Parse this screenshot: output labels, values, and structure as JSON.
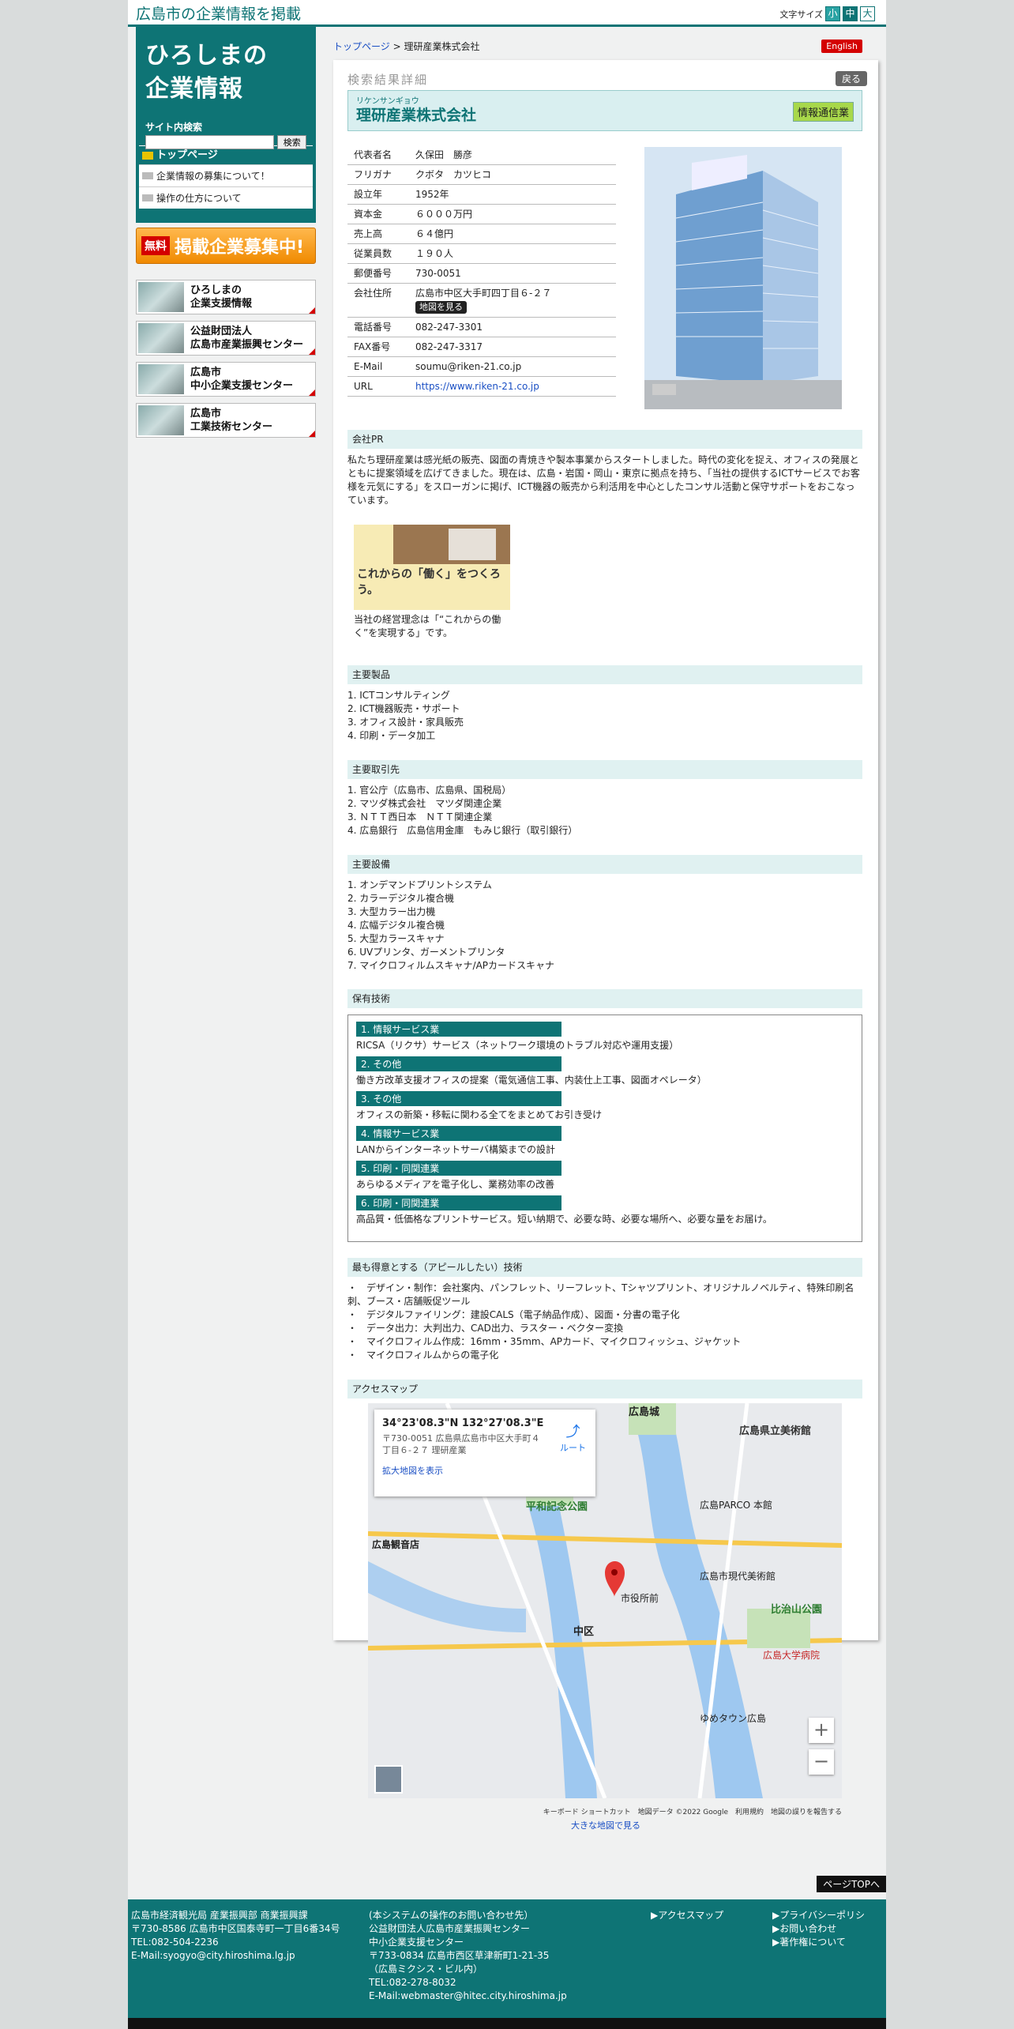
{
  "site": {
    "name": "広島市の企業情報を掲載",
    "font_size_label": "文字サイズ",
    "sizes": [
      "小",
      "中",
      "大"
    ]
  },
  "sidebar": {
    "logo": [
      "ひろしまの",
      "企業情報"
    ],
    "search_label": "サイト内検索",
    "search_button": "検索",
    "nav_head": "トップページ",
    "nav_items": [
      "企業情報の募集について！",
      "操作の仕方について"
    ],
    "banner_free": "無料",
    "banner_text": "掲載企業募集中!",
    "links": [
      [
        "ひろしまの",
        "企業支援情報"
      ],
      [
        "公益財団法人",
        "広島市産業振興センター"
      ],
      [
        "広島市",
        "中小企業支援センター"
      ],
      [
        "広島市",
        "工業技術センター"
      ]
    ]
  },
  "breadcrumb": {
    "home": "トップページ",
    "sep": " > ",
    "current": "理研産業株式会社"
  },
  "english": "English",
  "result_title": "検索結果詳細",
  "back": "戻る",
  "company": {
    "furigana": "リケンサンギョウ",
    "name": "理研産業株式会社",
    "industry": "情報通信業"
  },
  "info": [
    {
      "k": "代表者名",
      "v": "久保田　勝彦"
    },
    {
      "k": "フリガナ",
      "v": "クボタ　カツヒコ"
    },
    {
      "k": "設立年",
      "v": "1952年"
    },
    {
      "k": "資本金",
      "v": "６０００万円"
    },
    {
      "k": "売上高",
      "v": "６４億円"
    },
    {
      "k": "従業員数",
      "v": "１９０人"
    },
    {
      "k": "郵便番号",
      "v": "730-0051"
    },
    {
      "k": "会社住所",
      "v": "広島市中区大手町四丁目６-２７"
    },
    {
      "k": "電話番号",
      "v": "082-247-3301"
    },
    {
      "k": "FAX番号",
      "v": "082-247-3317"
    },
    {
      "k": "E-Mail",
      "v": "soumu@riken-21.co.jp"
    },
    {
      "k": "URL",
      "v": "https://www.riken-21.co.jp"
    }
  ],
  "map_button": "地図を見る",
  "pr": {
    "head": "会社PR",
    "text": "私たち理研産業は感光紙の販売、図面の青焼きや製本事業からスタートしました。時代の変化を捉え、オフィスの発展とともに提案領域を広げてきました。現在は、広島・岩国・岡山・東京に拠点を持ち、「当社の提供するICTサービスでお客様を元気にする」をスローガンに掲げ、ICT機器の販売から利活用を中心としたコンサル活動と保守サポートをおこなっています。",
    "image_caption_text": "これからの「働く」をつくろう。",
    "caption": "当社の経営理念は「“これからの働く”を実現する」です。"
  },
  "products": {
    "head": "主要製品",
    "items": [
      "1. ICTコンサルティング",
      "2. ICT機器販売・サポート",
      "3. オフィス設計・家具販売",
      "4. 印刷・データ加工"
    ]
  },
  "clients": {
    "head": "主要取引先",
    "items": [
      "1. 官公庁（広島市、広島県、国税局）",
      "2. マツダ株式会社　マツダ関連企業",
      "3. ＮＴＴ西日本　ＮＴＴ関連企業",
      "4. 広島銀行　広島信用金庫　もみじ銀行（取引銀行）"
    ]
  },
  "equipment": {
    "head": "主要設備",
    "items": [
      "1. オンデマンドプリントシステム",
      "2. カラーデジタル複合機",
      "3. 大型カラー出力機",
      "4. 広幅デジタル複合機",
      "5. 大型カラースキャナ",
      "6. UVプリンタ、ガーメントプリンタ",
      "7. マイクロフィルムスキャナ/APカードスキャナ"
    ]
  },
  "tech": {
    "head": "保有技術",
    "items": [
      {
        "label": "1. 情報サービス業",
        "desc": "RICSA（リクサ）サービス（ネットワーク環境のトラブル対応や運用支援）"
      },
      {
        "label": "2. その他",
        "desc": "働き方改革支援オフィスの提案（電気通信工事、内装仕上工事、図面オペレータ）"
      },
      {
        "label": "3. その他",
        "desc": "オフィスの新築・移転に関わる全てをまとめてお引き受け"
      },
      {
        "label": "4. 情報サービス業",
        "desc": "LANからインターネットサーバ構築までの設計"
      },
      {
        "label": "5. 印刷・同関連業",
        "desc": "あらゆるメディアを電子化し、業務効率の改善"
      },
      {
        "label": "6. 印刷・同関連業",
        "desc": "高品質・低価格なプリントサービス。短い納期で、必要な時、必要な場所へ、必要な量をお届け。"
      }
    ]
  },
  "appeal": {
    "head": "最も得意とする（アピールしたい）技術",
    "items": [
      "・　デザイン・制作：会社案内、パンフレット、リーフレット、Tシャツプリント、オリジナルノベルティ、特殊印刷名刺、ブース・店舗販促ツール",
      "・　デジタルファイリング：建設CALS（電子納品作成）、図面・分書の電子化",
      "・　データ出力：大判出力、CAD出力、ラスター・ベクター変換",
      "・　マイクロフィルム作成：16mm・35mm、APカード、マイクロフィッシュ、ジャケット",
      "・　マイクロフィルムからの電子化"
    ]
  },
  "access": {
    "head": "アクセスマップ",
    "coord": "34°23'08.3\"N 132°27'08.3\"E",
    "address": "〒730-0051 広島県広島市中区大手町４丁目６-２７ 理研産業",
    "route": "ルート",
    "enlarge": "拡大地図を表示",
    "footer": "キーボード ショートカット　地図データ ©2022 Google　利用規約　地図の誤りを報告する",
    "big_map": "大きな地図で見る",
    "labels": [
      "広島城",
      "広島県立美術館",
      "平和記念公園",
      "広島PARCO 本館",
      "広島市現代美術館",
      "比治山公園",
      "広島大学病院",
      "中区",
      "市役所前",
      "広島観音店",
      "ゆめタウン広島"
    ]
  },
  "pagetop": "ページTOPへ",
  "footer": {
    "col1": [
      "広島市経済観光局 産業振興部 商業振興課",
      "〒730-8586 広島市中区国泰寺町一丁目6番34号",
      "TEL:082-504-2236",
      "E-Mail:syogyo@city.hiroshima.lg.jp"
    ],
    "col2": [
      "(本システムの操作のお問い合わせ先）",
      "公益財団法人広島市産業振興センター",
      "中小企業支援センター",
      "〒733-0834 広島市西区草津新町1-21-35",
      "（広島ミクシス・ビル内）",
      "TEL:082-278-8032",
      "E-Mail:webmaster@hitec.city.hiroshima.jp"
    ],
    "col3": [
      "▶アクセスマップ"
    ],
    "col4": [
      "▶プライバシーポリシ",
      "▶お問い合わせ",
      "▶著作権について"
    ]
  },
  "colors": {
    "accent": "#0e7475",
    "light": "#e0f1f1",
    "red": "#d40000"
  }
}
